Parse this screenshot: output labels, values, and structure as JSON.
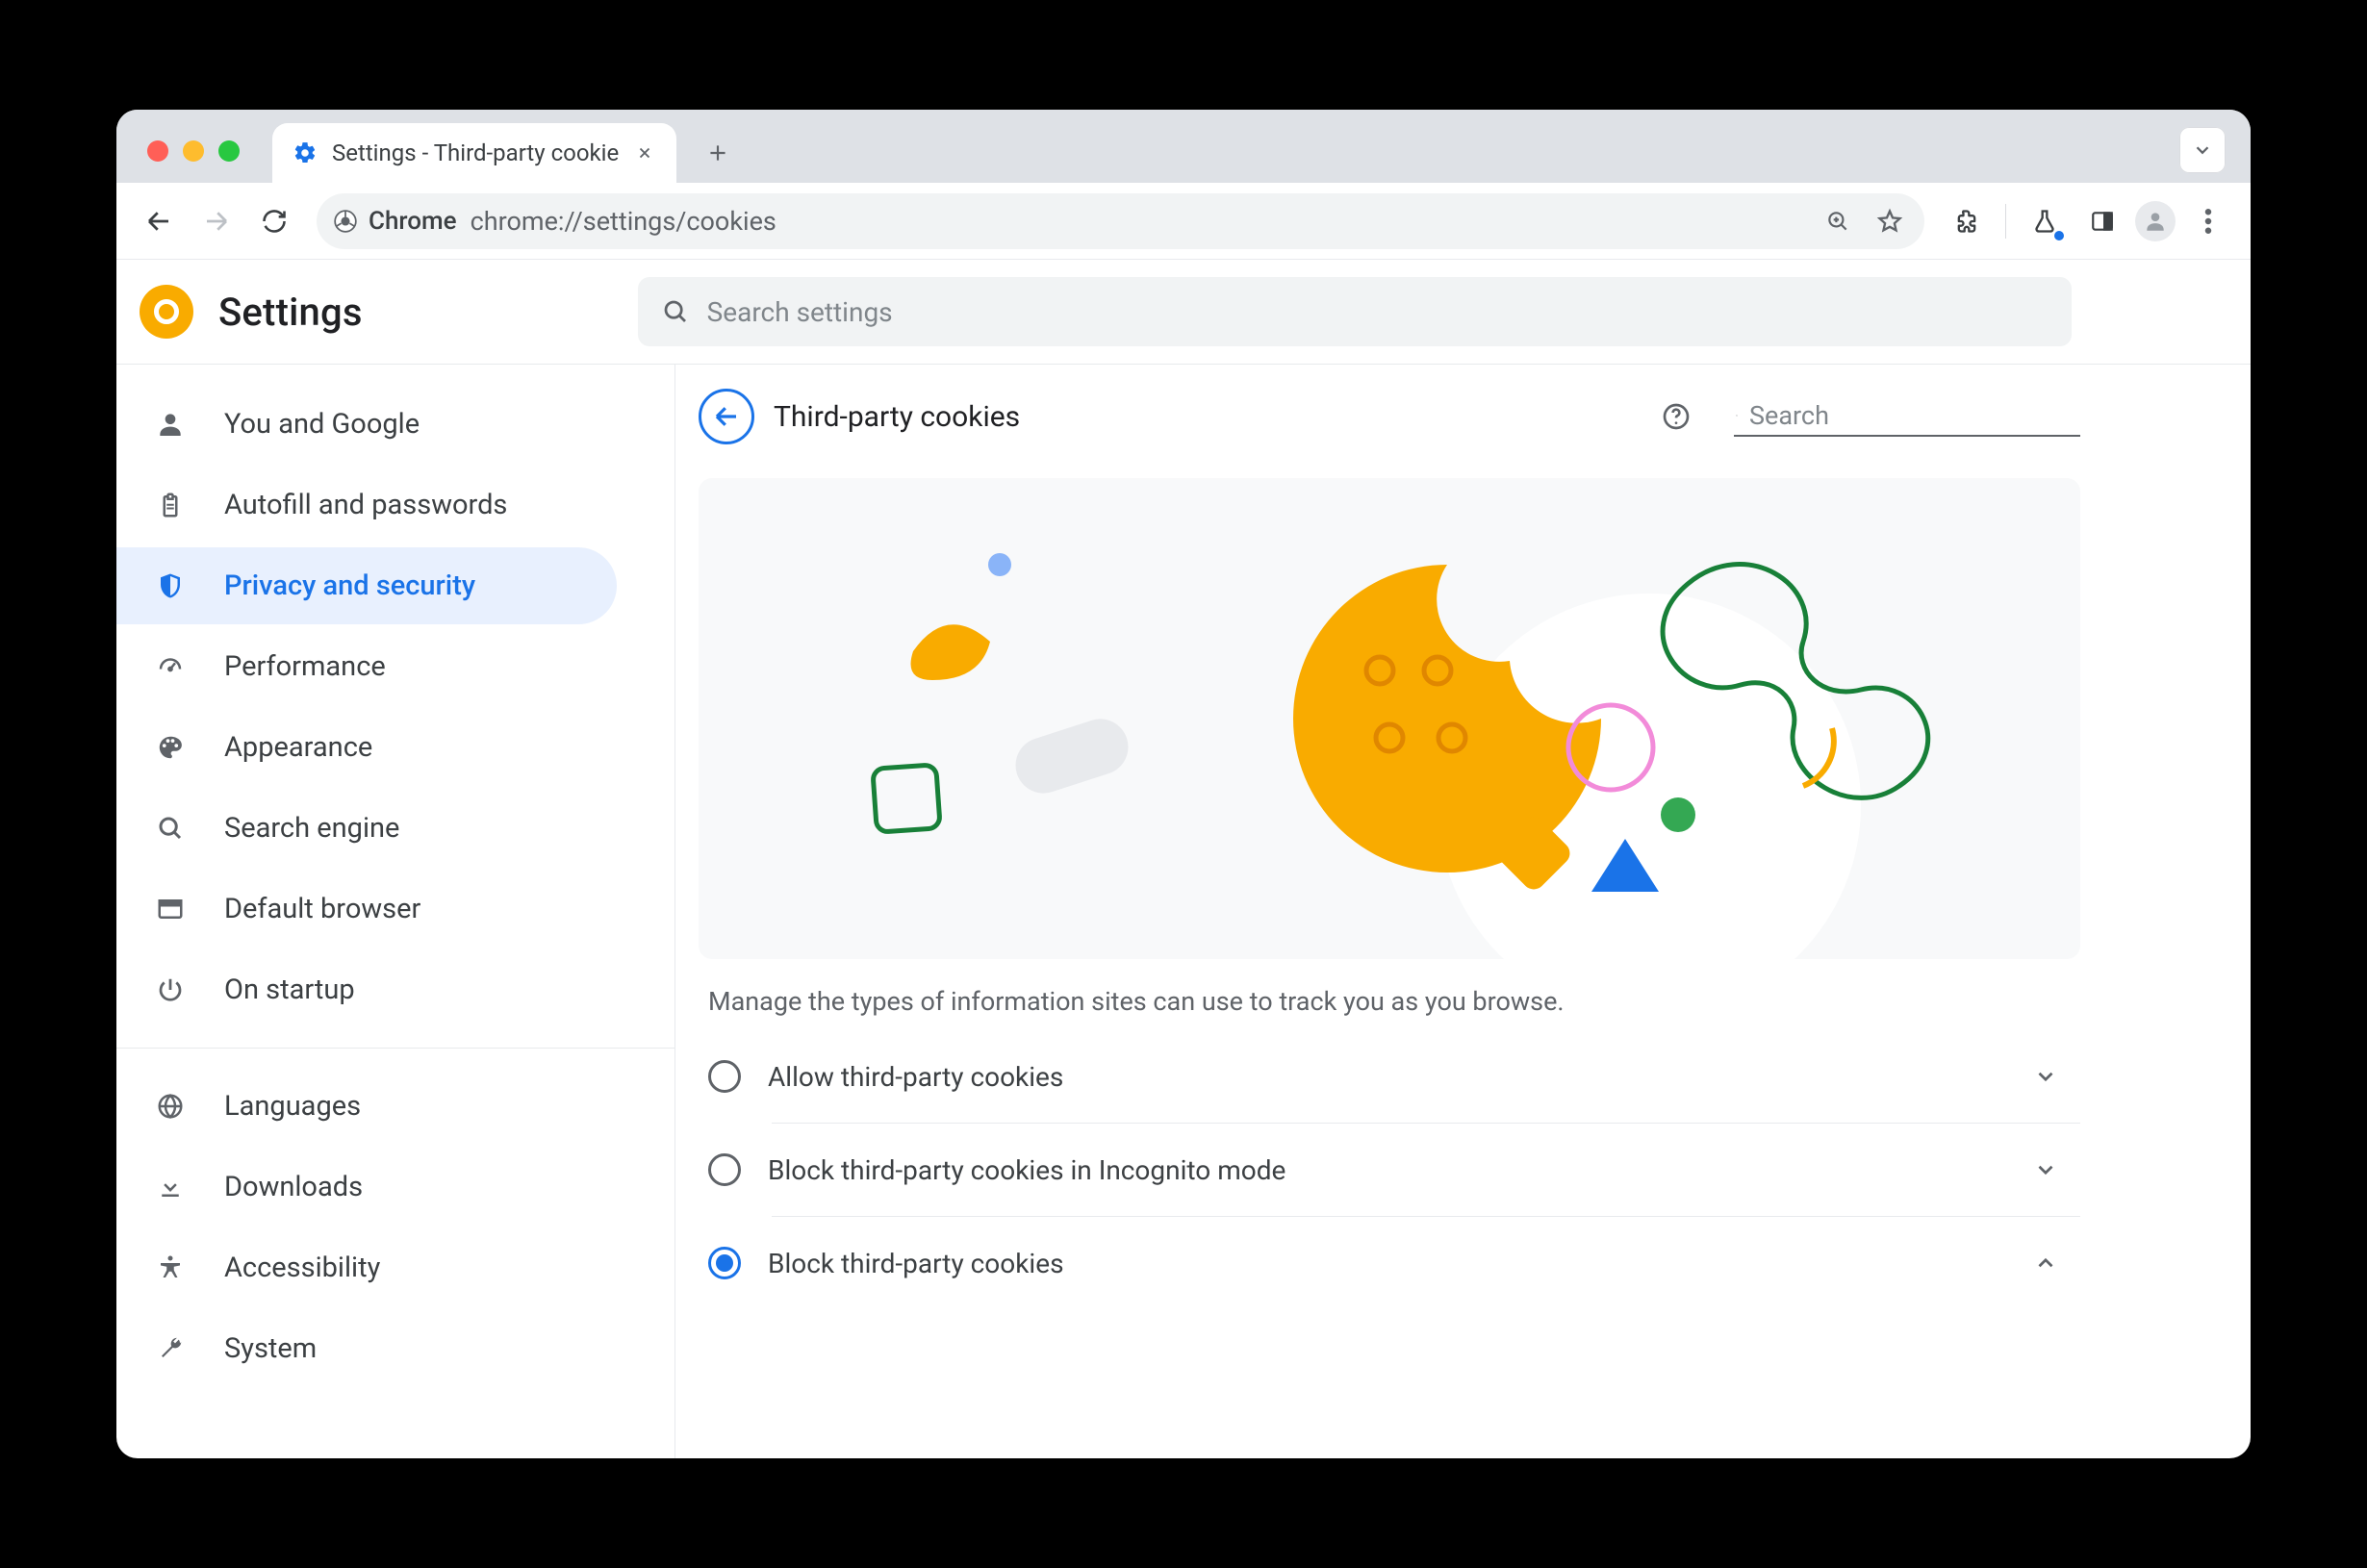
{
  "tab": {
    "title": "Settings - Third-party cookie"
  },
  "toolbar": {
    "chip_label": "Chrome",
    "url": "chrome://settings/cookies"
  },
  "app": {
    "title": "Settings"
  },
  "search_settings": {
    "placeholder": "Search settings"
  },
  "sidebar": {
    "items": [
      {
        "label": "You and Google"
      },
      {
        "label": "Autofill and passwords"
      },
      {
        "label": "Privacy and security"
      },
      {
        "label": "Performance"
      },
      {
        "label": "Appearance"
      },
      {
        "label": "Search engine"
      },
      {
        "label": "Default browser"
      },
      {
        "label": "On startup"
      }
    ],
    "items2": [
      {
        "label": "Languages"
      },
      {
        "label": "Downloads"
      },
      {
        "label": "Accessibility"
      },
      {
        "label": "System"
      }
    ]
  },
  "page": {
    "title": "Third-party cookies",
    "search_placeholder": "Search",
    "intro": "Manage the types of information sites can use to track you as you browse.",
    "options": [
      {
        "label": "Allow third-party cookies",
        "selected": false,
        "expanded": false
      },
      {
        "label": "Block third-party cookies in Incognito mode",
        "selected": false,
        "expanded": false
      },
      {
        "label": "Block third-party cookies",
        "selected": true,
        "expanded": true
      }
    ]
  },
  "colors": {
    "accent": "#1a73e8",
    "cookie": "#f9ab00",
    "green": "#188038",
    "green2": "#34a853",
    "pink": "#f28bd9",
    "blue_tri": "#1a73e8",
    "grey_pill": "#e8eaed",
    "blue_dot": "#8ab4f8"
  }
}
